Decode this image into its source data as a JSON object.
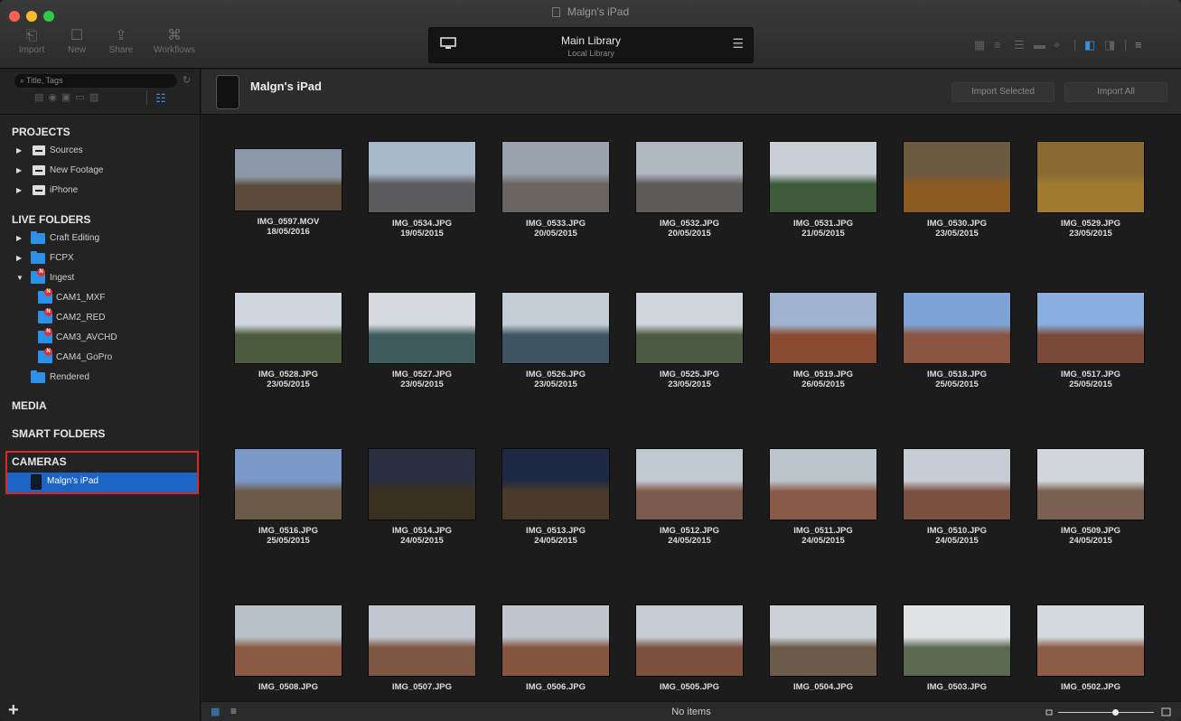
{
  "window": {
    "title": "Malgn's iPad",
    "close_color": "#fc5f57",
    "min_color": "#fdbc2e",
    "max_color": "#34c84a"
  },
  "toolbar": {
    "buttons": [
      {
        "label": "Import",
        "icon": "import-icon"
      },
      {
        "label": "New",
        "icon": "new-icon"
      },
      {
        "label": "Share",
        "icon": "share-icon"
      },
      {
        "label": "Workflows",
        "icon": "workflows-icon"
      }
    ],
    "library": {
      "title": "Main Library",
      "subtitle": "Local Library"
    },
    "view_icons": [
      "grid-view-icon",
      "list-view-icon",
      "detail-view-icon",
      "filmstrip-view-icon",
      "map-view-icon",
      "left-panel-icon",
      "right-panel-icon",
      "sort-icon"
    ]
  },
  "sidebar": {
    "search_placeholder": "Title, Tags",
    "filters": [
      "video-filter-icon",
      "audio-filter-icon",
      "image-filter-icon",
      "document-filter-icon",
      "other-filter-icon"
    ],
    "sections": {
      "projects": "PROJECTS",
      "live_folders": "LIVE FOLDERS",
      "media": "MEDIA",
      "smart_folders": "SMART FOLDERS",
      "cameras": "CAMERAS"
    },
    "projects": [
      "Sources",
      "New Footage",
      "iPhone"
    ],
    "live_folders": [
      "Craft Editing",
      "FCPX",
      "Ingest"
    ],
    "ingest_children": [
      "CAM1_MXF",
      "CAM2_RED",
      "CAM3_AVCHD",
      "CAM4_GoPro"
    ],
    "rendered": "Rendered",
    "camera_device": "Malgn's iPad",
    "accent_color": "#1b63c4",
    "highlight_color": "#d42a1f"
  },
  "main": {
    "device_name": "Malgn's iPad",
    "import_selected": "Import Selected",
    "import_all": "Import All",
    "status": "No items",
    "items": [
      {
        "name": "IMG_0597.MOV",
        "date": "18/05/2016"
      },
      {
        "name": "IMG_0534.JPG",
        "date": "19/05/2015"
      },
      {
        "name": "IMG_0533.JPG",
        "date": "20/05/2015"
      },
      {
        "name": "IMG_0532.JPG",
        "date": "20/05/2015"
      },
      {
        "name": "IMG_0531.JPG",
        "date": "21/05/2015"
      },
      {
        "name": "IMG_0530.JPG",
        "date": "23/05/2015"
      },
      {
        "name": "IMG_0529.JPG",
        "date": "23/05/2015"
      },
      {
        "name": "IMG_0528.JPG",
        "date": "23/05/2015"
      },
      {
        "name": "IMG_0527.JPG",
        "date": "23/05/2015"
      },
      {
        "name": "IMG_0526.JPG",
        "date": "23/05/2015"
      },
      {
        "name": "IMG_0525.JPG",
        "date": "23/05/2015"
      },
      {
        "name": "IMG_0519.JPG",
        "date": "26/05/2015"
      },
      {
        "name": "IMG_0518.JPG",
        "date": "25/05/2015"
      },
      {
        "name": "IMG_0517.JPG",
        "date": "25/05/2015"
      },
      {
        "name": "IMG_0516.JPG",
        "date": "25/05/2015"
      },
      {
        "name": "IMG_0514.JPG",
        "date": "24/05/2015"
      },
      {
        "name": "IMG_0513.JPG",
        "date": "24/05/2015"
      },
      {
        "name": "IMG_0512.JPG",
        "date": "24/05/2015"
      },
      {
        "name": "IMG_0511.JPG",
        "date": "24/05/2015"
      },
      {
        "name": "IMG_0510.JPG",
        "date": "24/05/2015"
      },
      {
        "name": "IMG_0509.JPG",
        "date": "24/05/2015"
      },
      {
        "name": "IMG_0508.JPG",
        "date": ""
      },
      {
        "name": "IMG_0507.JPG",
        "date": ""
      },
      {
        "name": "IMG_0506.JPG",
        "date": ""
      },
      {
        "name": "IMG_0505.JPG",
        "date": ""
      },
      {
        "name": "IMG_0504.JPG",
        "date": ""
      },
      {
        "name": "IMG_0503.JPG",
        "date": ""
      },
      {
        "name": "IMG_0502.JPG",
        "date": ""
      }
    ]
  },
  "statusbar": {
    "zoom_level": 0.6
  }
}
